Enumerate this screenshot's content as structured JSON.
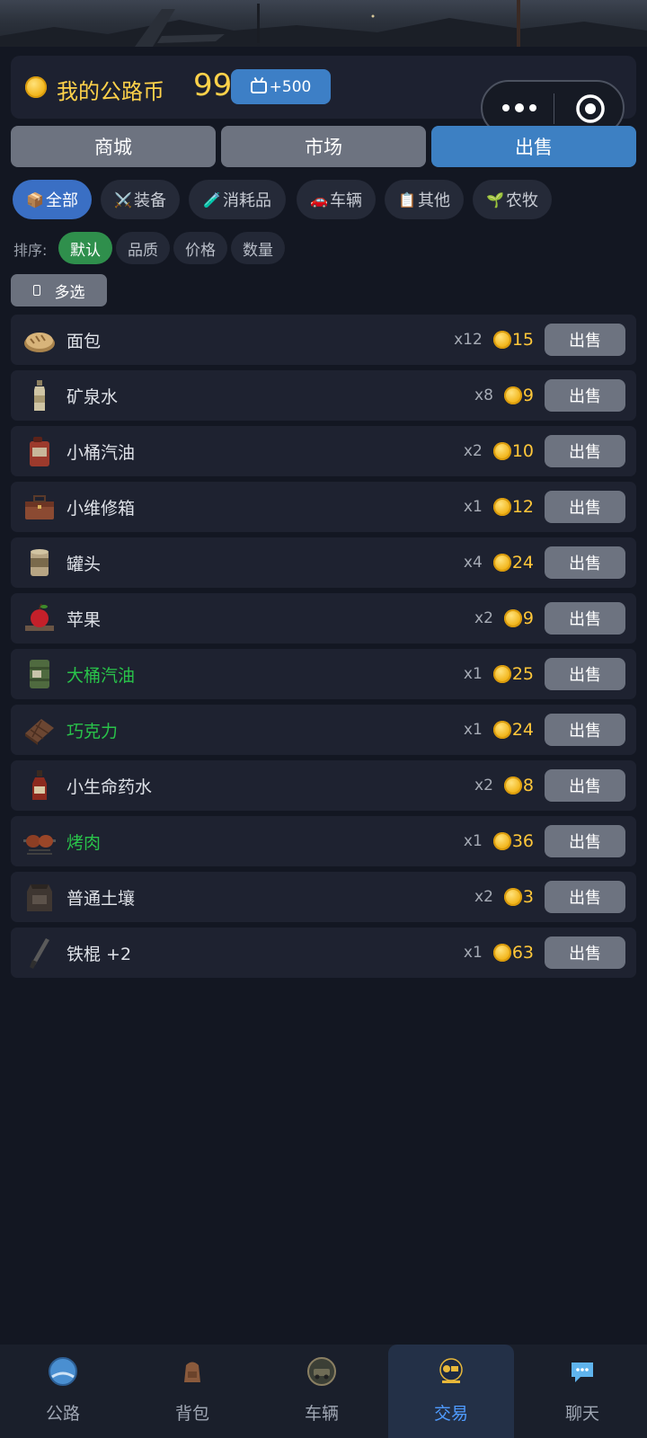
{
  "header": {
    "coin_label": "我的公路币",
    "coin_value": "99",
    "ad_bonus": "+500"
  },
  "main_tabs": [
    {
      "label": "商城",
      "active": false
    },
    {
      "label": "市场",
      "active": false
    },
    {
      "label": "出售",
      "active": true
    }
  ],
  "categories": [
    {
      "icon": "📦",
      "label": "全部",
      "active": true
    },
    {
      "icon": "⚔️",
      "label": "装备",
      "active": false
    },
    {
      "icon": "🧪",
      "label": "消耗品",
      "active": false
    },
    {
      "icon": "🚗",
      "label": "车辆",
      "active": false
    },
    {
      "icon": "📋",
      "label": "其他",
      "active": false
    },
    {
      "icon": "🌱",
      "label": "农牧",
      "active": false
    }
  ],
  "sort": {
    "label": "排序:",
    "options": [
      {
        "label": "默认",
        "active": true
      },
      {
        "label": "品质",
        "active": false
      },
      {
        "label": "价格",
        "active": false
      },
      {
        "label": "数量",
        "active": false
      }
    ]
  },
  "multi_select_label": "多选",
  "sell_label": "出售",
  "items": [
    {
      "name": "面包",
      "qty": "x12",
      "price": "15",
      "icon": "bread-icon",
      "quality": "normal"
    },
    {
      "name": "矿泉水",
      "qty": "x8",
      "price": "9",
      "icon": "water-bottle-icon",
      "quality": "normal"
    },
    {
      "name": "小桶汽油",
      "qty": "x2",
      "price": "10",
      "icon": "jerrycan-icon",
      "quality": "normal"
    },
    {
      "name": "小维修箱",
      "qty": "x1",
      "price": "12",
      "icon": "toolbox-icon",
      "quality": "normal"
    },
    {
      "name": "罐头",
      "qty": "x4",
      "price": "24",
      "icon": "can-icon",
      "quality": "normal"
    },
    {
      "name": "苹果",
      "qty": "x2",
      "price": "9",
      "icon": "apple-icon",
      "quality": "normal"
    },
    {
      "name": "大桶汽油",
      "qty": "x1",
      "price": "25",
      "icon": "oil-barrel-icon",
      "quality": "green"
    },
    {
      "name": "巧克力",
      "qty": "x1",
      "price": "24",
      "icon": "chocolate-icon",
      "quality": "green"
    },
    {
      "name": "小生命药水",
      "qty": "x2",
      "price": "8",
      "icon": "potion-icon",
      "quality": "normal"
    },
    {
      "name": "烤肉",
      "qty": "x1",
      "price": "36",
      "icon": "grilled-meat-icon",
      "quality": "green"
    },
    {
      "name": "普通土壤",
      "qty": "x2",
      "price": "3",
      "icon": "soil-sack-icon",
      "quality": "normal"
    },
    {
      "name": "铁棍 +2",
      "qty": "x1",
      "price": "63",
      "icon": "iron-rod-icon",
      "quality": "normal"
    }
  ],
  "bottom_nav": [
    {
      "label": "公路",
      "icon": "road-icon",
      "active": false
    },
    {
      "label": "背包",
      "icon": "backpack-icon",
      "active": false
    },
    {
      "label": "车辆",
      "icon": "vehicle-icon",
      "active": false
    },
    {
      "label": "交易",
      "icon": "trade-icon",
      "active": true
    },
    {
      "label": "聊天",
      "icon": "chat-icon",
      "active": false
    }
  ],
  "colors": {
    "accent_blue": "#3d80c3",
    "coin_gold": "#ffd24a",
    "quality_green": "#29c34a",
    "sort_active": "#2f8f4c"
  }
}
